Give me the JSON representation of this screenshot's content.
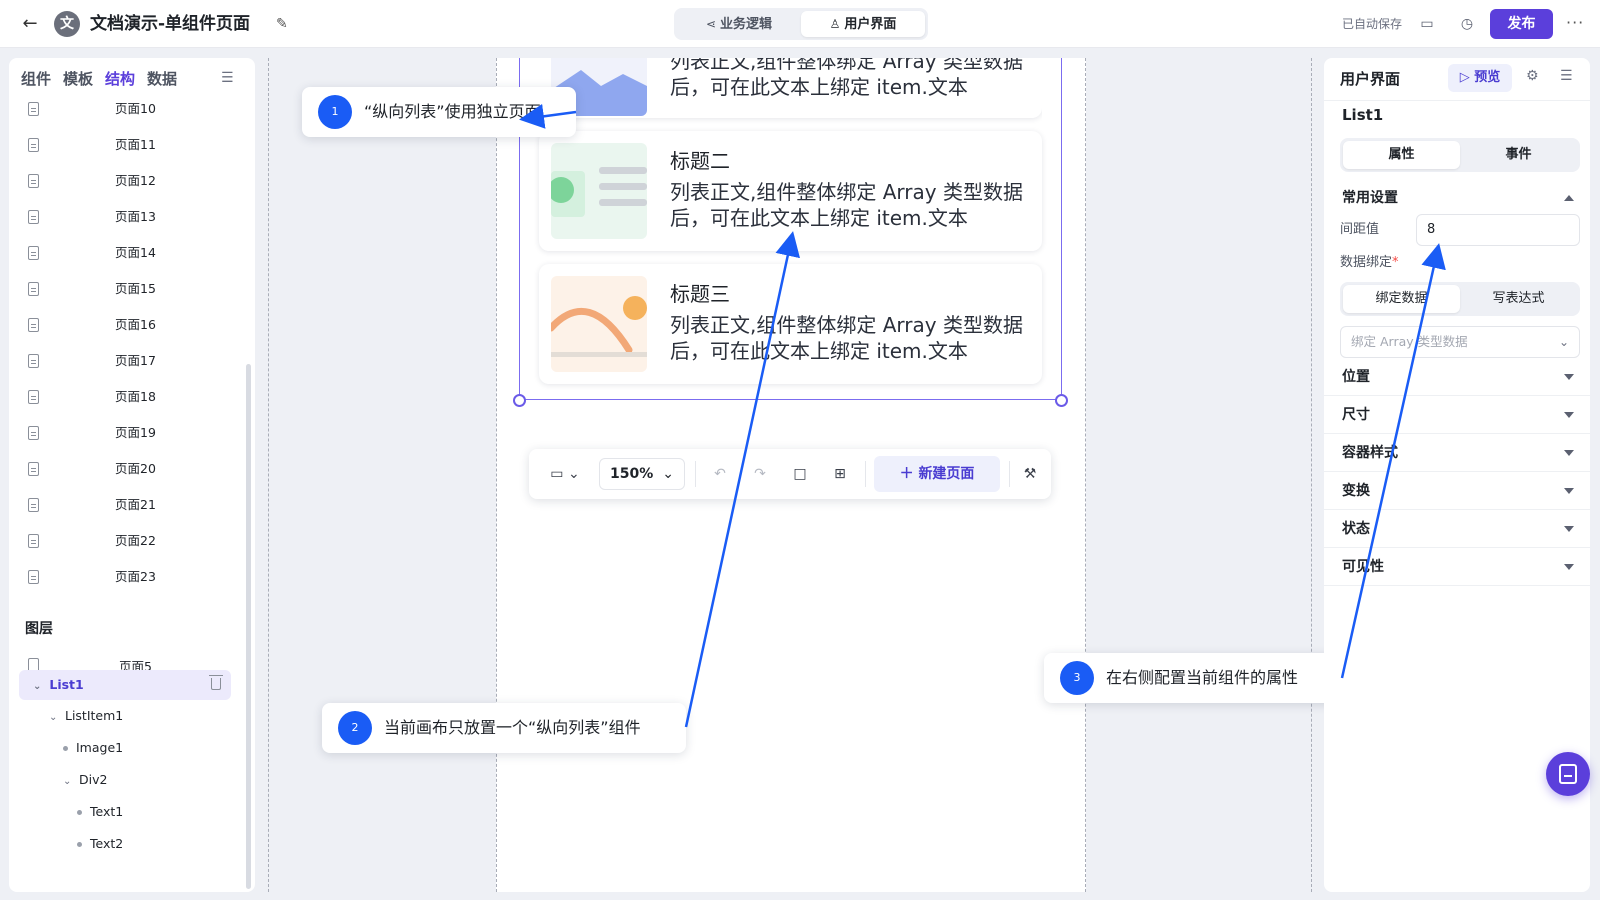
{
  "header": {
    "logo_char": "文",
    "title": "文档演示-单组件页面",
    "modes": [
      {
        "label": "业务逻辑",
        "icon": "share-icon"
      },
      {
        "label": "用户界面",
        "icon": "user-icon"
      }
    ],
    "active_mode": "用户界面",
    "autosave": "已自动保存",
    "publish_label": "发布"
  },
  "left_panel": {
    "tabs": [
      "组件",
      "模板",
      "结构",
      "数据"
    ],
    "active_tab": "结构",
    "pages": [
      "页面10",
      "页面11",
      "页面12",
      "页面13",
      "页面14",
      "页面15",
      "页面16",
      "页面17",
      "页面18",
      "页面19",
      "页面20",
      "页面21",
      "页面22",
      "页面23"
    ],
    "layers_title": "图层",
    "layer_page": "页面5",
    "tree": [
      {
        "label": "List1",
        "depth": 0,
        "caret": true,
        "selected": true
      },
      {
        "label": "ListItem1",
        "depth": 1,
        "caret": true
      },
      {
        "label": "Image1",
        "depth": 2,
        "dot": true
      },
      {
        "label": "Div2",
        "depth": 2,
        "caret": true
      },
      {
        "label": "Text1",
        "depth": 3,
        "dot": true
      },
      {
        "label": "Text2",
        "depth": 3,
        "dot": true
      }
    ]
  },
  "canvas": {
    "cards": [
      {
        "title": "",
        "body": "列表正文,组件整体绑定 Array 类型数据后，可在此文本上绑定 item.文本"
      },
      {
        "title": "标题二",
        "body": "列表正文,组件整体绑定 Array 类型数据后，可在此文本上绑定 item.文本"
      },
      {
        "title": "标题三",
        "body": "列表正文,组件整体绑定 Array 类型数据后，可在此文本上绑定 item.文本"
      }
    ],
    "toolbar": {
      "zoom": "150%",
      "new_page_label": "新建页面"
    }
  },
  "callouts": [
    {
      "num": "1",
      "text": "“纵向列表”使用独立页面"
    },
    {
      "num": "2",
      "text": "当前画布只放置一个“纵向列表”组件"
    },
    {
      "num": "3",
      "text": "在右侧配置当前组件的属性"
    }
  ],
  "right_panel": {
    "title": "用户界面",
    "preview_label": "预览",
    "component_name": "List1",
    "tabs": [
      "属性",
      "事件"
    ],
    "active_tab": "属性",
    "common_settings": "常用设置",
    "spacing_label": "间距值",
    "spacing_value": "8",
    "binding_label": "数据绑定",
    "binding_required": "*",
    "binding_modes": [
      "绑定数据",
      "写表达式"
    ],
    "binding_placeholder": "绑定 Array 类型数据",
    "sections": [
      "位置",
      "尺寸",
      "容器样式",
      "变换",
      "状态",
      "可见性"
    ]
  },
  "colors": {
    "accent": "#5b3fdb",
    "callout_number": "#1a5cf5",
    "selection": "#6b5be8"
  }
}
